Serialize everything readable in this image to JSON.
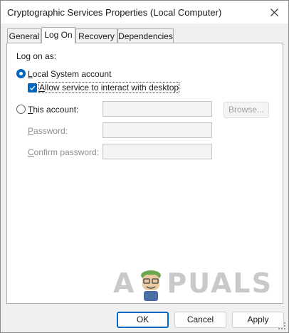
{
  "window": {
    "title": "Cryptographic Services Properties (Local Computer)"
  },
  "tabs": [
    {
      "label": "General"
    },
    {
      "label": "Log On"
    },
    {
      "label": "Recovery"
    },
    {
      "label": "Dependencies"
    }
  ],
  "logon": {
    "section_label": "Log on as:",
    "local_system_label": "Local System account",
    "local_system_selected": true,
    "interact_label": "Allow service to interact with desktop",
    "interact_checked": true,
    "this_account_label": "This account:",
    "this_account_value": "",
    "browse_label": "Browse...",
    "password_label": "Password:",
    "password_value": "",
    "confirm_label": "Confirm password:",
    "confirm_value": ""
  },
  "buttons": {
    "ok": "OK",
    "cancel": "Cancel",
    "apply": "Apply"
  },
  "watermark": {
    "text": "APPUALS"
  },
  "colors": {
    "accent": "#0067c0",
    "panel": "#ffffff",
    "chrome": "#f0f0f0"
  }
}
